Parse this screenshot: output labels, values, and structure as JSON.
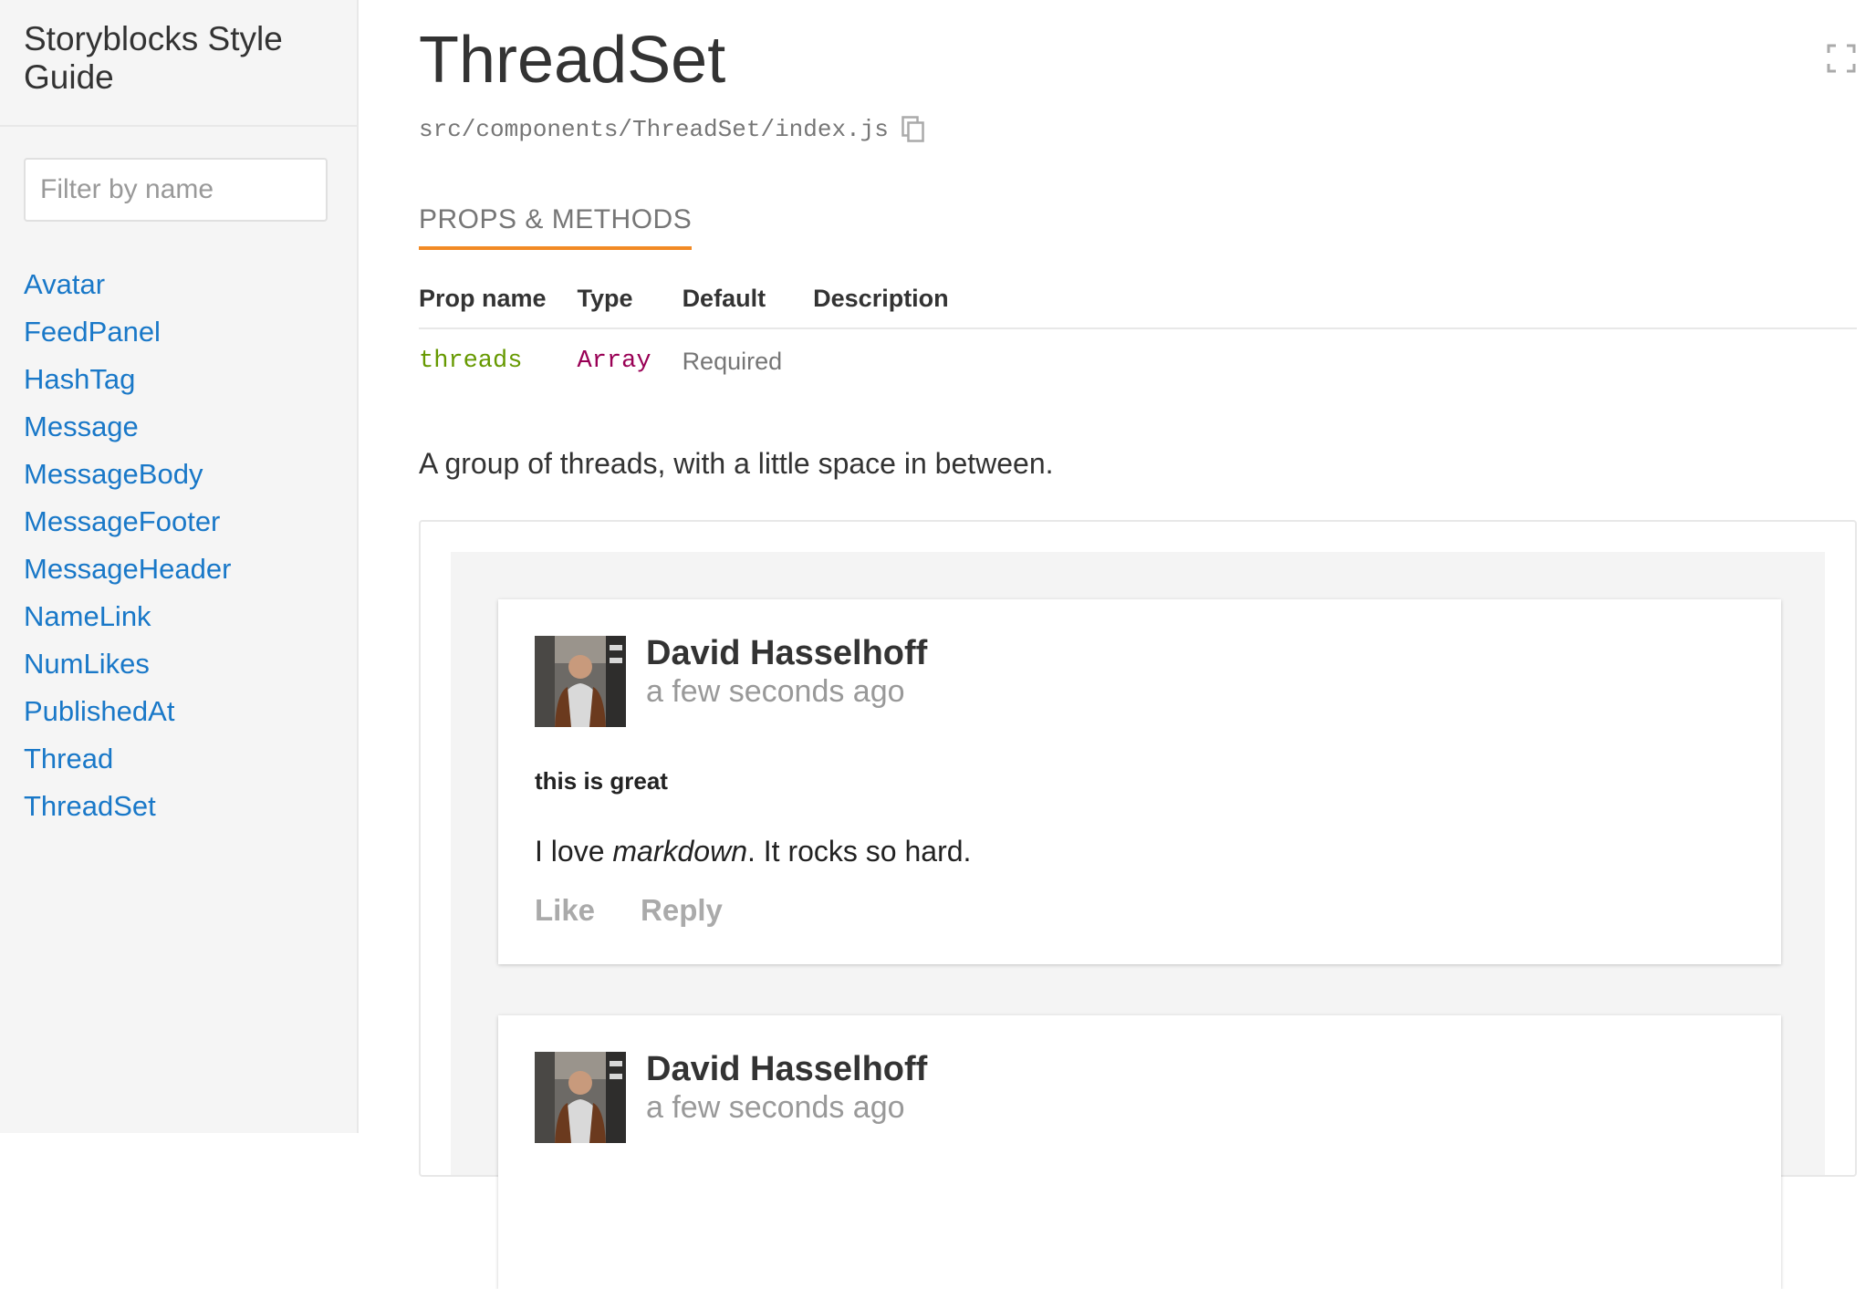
{
  "sidebar": {
    "logo": "Storyblocks Style Guide",
    "filter_placeholder": "Filter by name",
    "items": [
      "Avatar",
      "FeedPanel",
      "HashTag",
      "Message",
      "MessageBody",
      "MessageFooter",
      "MessageHeader",
      "NameLink",
      "NumLikes",
      "PublishedAt",
      "Thread",
      "ThreadSet"
    ]
  },
  "main": {
    "title": "ThreadSet",
    "path": "src/components/ThreadSet/index.js",
    "tab": "PROPS & METHODS",
    "table": {
      "headers": [
        "Prop name",
        "Type",
        "Default",
        "Description"
      ],
      "rows": [
        {
          "name": "threads",
          "type": "Array",
          "default": "Required",
          "description": ""
        }
      ]
    },
    "description": "A group of threads, with a little space in between."
  },
  "example": {
    "threads": [
      {
        "author": "David Hasselhoff",
        "time": "a few seconds ago",
        "title": "this is great",
        "body_before": "I love ",
        "body_em": "markdown",
        "body_after": ". It rocks so hard.",
        "like_label": "Like",
        "reply_label": "Reply"
      },
      {
        "author": "David Hasselhoff",
        "time": "a few seconds ago"
      }
    ]
  },
  "colors": {
    "link": "#1978c8",
    "accent_tab_underline": "#f28a25",
    "prop_name": "#669900",
    "prop_type": "#990055"
  },
  "icons": [
    "copy-icon",
    "fullscreen-icon"
  ]
}
